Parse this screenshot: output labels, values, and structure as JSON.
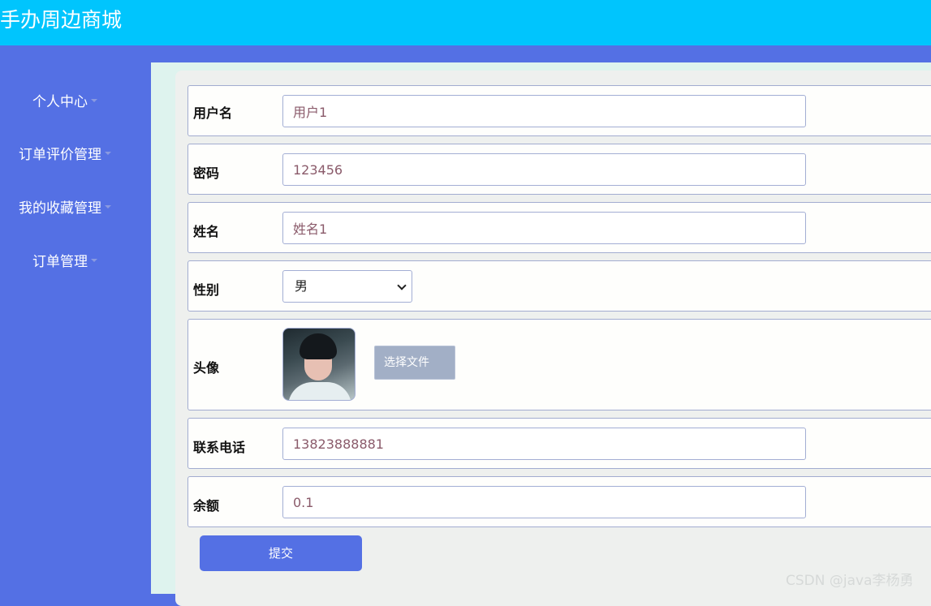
{
  "app": {
    "title": "手办周边商城"
  },
  "sidebar": {
    "items": [
      {
        "label": "个人中心"
      },
      {
        "label": "订单评价管理"
      },
      {
        "label": "我的收藏管理"
      },
      {
        "label": "订单管理"
      }
    ]
  },
  "form": {
    "username": {
      "label": "用户名",
      "value": "用户1"
    },
    "password": {
      "label": "密码",
      "value": "123456"
    },
    "name": {
      "label": "姓名",
      "value": "姓名1"
    },
    "gender": {
      "label": "性别",
      "value": "男"
    },
    "avatar": {
      "label": "头像",
      "button": "选择文件"
    },
    "phone": {
      "label": "联系电话",
      "value": "13823888881"
    },
    "balance": {
      "label": "余额",
      "value": "0.1"
    },
    "submit": "提交"
  },
  "watermark": "CSDN @java李杨勇",
  "colors": {
    "header": "#00c5fd",
    "sidebar": "#5470e4",
    "accent": "#5470e4"
  }
}
